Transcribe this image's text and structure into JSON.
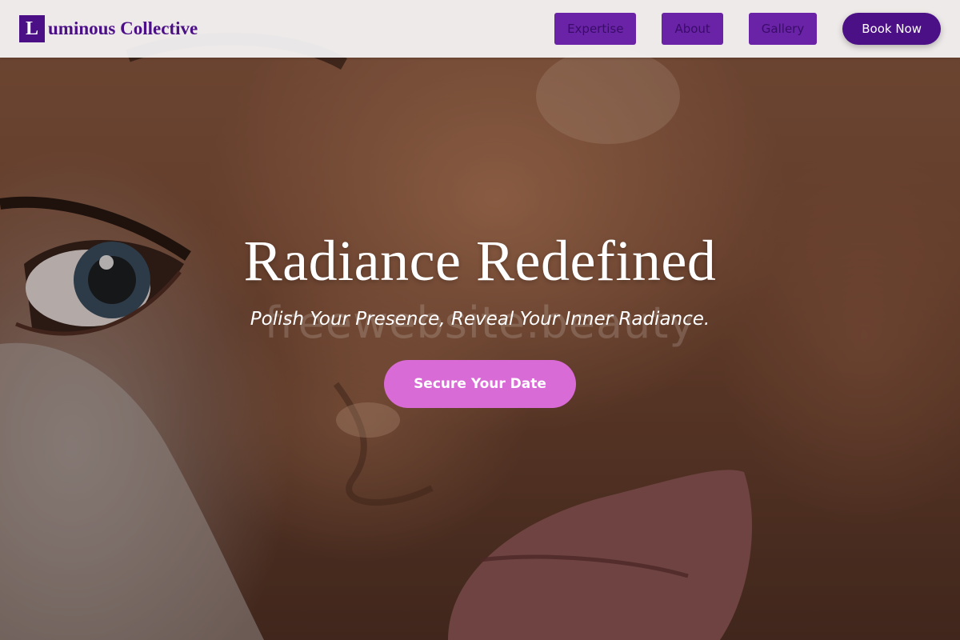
{
  "header": {
    "brand_initial": "L",
    "brand_rest": "uminous Collective",
    "nav": [
      {
        "label": "Expertise"
      },
      {
        "label": "About"
      },
      {
        "label": "Gallery"
      }
    ],
    "book_label": "Book Now"
  },
  "hero": {
    "title": "Radiance Redefined",
    "subtitle": "Polish Your Presence, Reveal Your Inner Radiance.",
    "watermark": "freewebsite.beauty",
    "cta_label": "Secure Your Date"
  },
  "colors": {
    "brand_purple": "#4b0f86",
    "nav_purple": "#6a23a6",
    "cta_pink": "#d86bd6",
    "header_bg": "#f8f6f8"
  }
}
